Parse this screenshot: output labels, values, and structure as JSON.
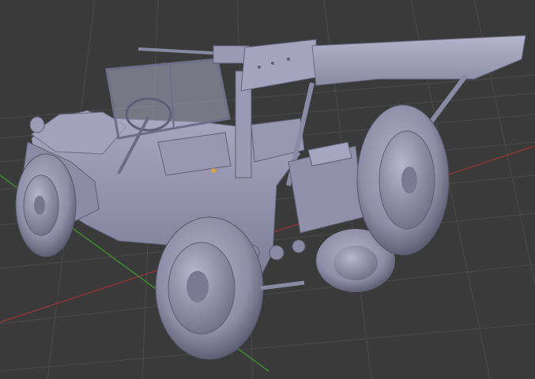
{
  "viewport": {
    "background_color": "#3a3a3a",
    "grid_color": "#4a4a4a",
    "x_axis_color": "#8a3535",
    "y_axis_color": "#3f8a2f",
    "model_color": "#9a9ab5",
    "model_shadow_color": "#6d6d86",
    "model_highlight_color": "#c4c4dc",
    "origin_marker_color": "#e0a040",
    "model_name": "jeep-with-mounted-gun"
  }
}
